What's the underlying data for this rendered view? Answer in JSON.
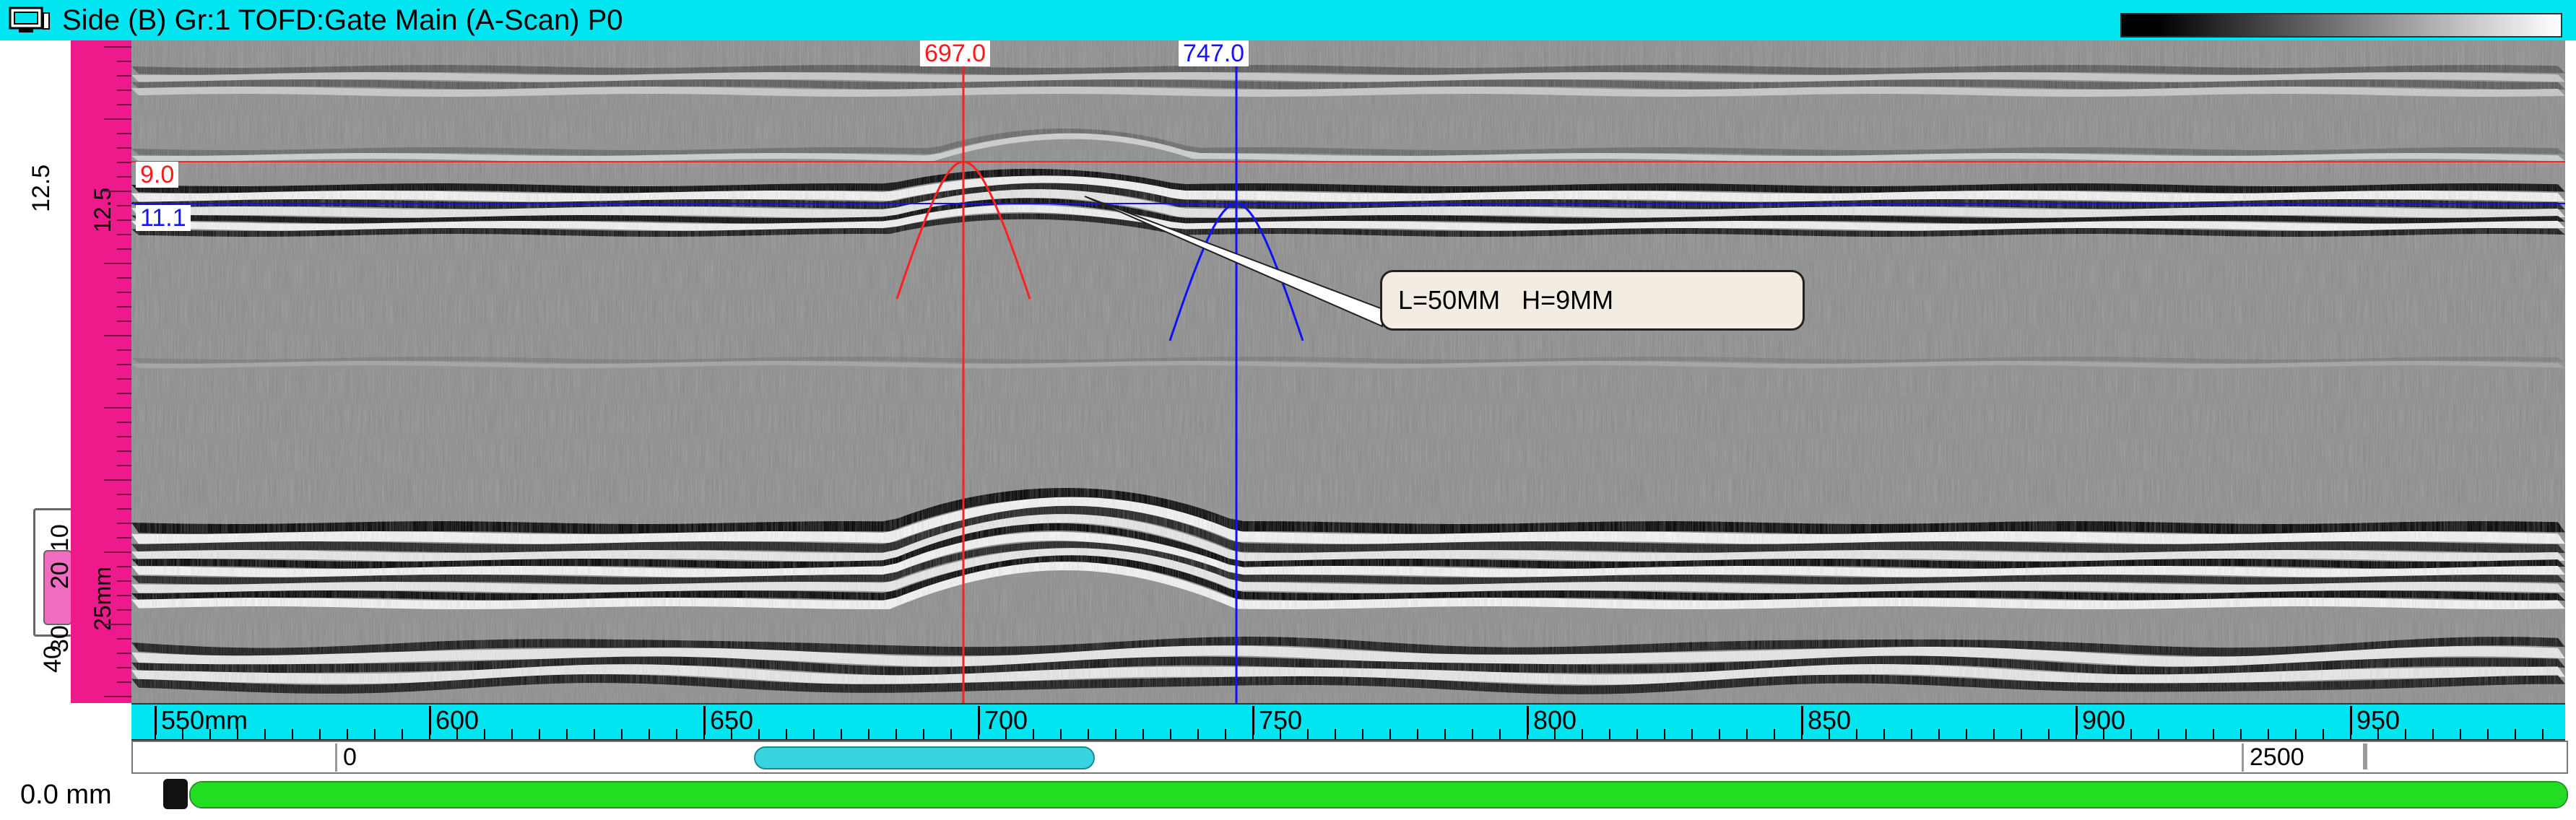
{
  "window": {
    "title": "Side (B) Gr:1 TOFD:Gate Main (A-Scan) P0",
    "icon": "monitor-icon",
    "accent_color": "#00e5f0"
  },
  "left_ruler": {
    "labels": [
      "12.5",
      "10",
      "20",
      "30",
      "25mm",
      "40"
    ]
  },
  "cursors": {
    "reference_position": "697.0",
    "measure_position": "747.0",
    "reference_depth": "9.0",
    "measure_depth": "11.1",
    "reference_color": "#ff2020",
    "measure_color": "#1010ff"
  },
  "measurement": {
    "label": "L=50MM   H=9MM"
  },
  "scan_axis": {
    "labels": [
      "550mm",
      "600",
      "650",
      "700",
      "750",
      "800",
      "850",
      "900",
      "950"
    ]
  },
  "scrollbar": {
    "start_label": "0",
    "end_label": "2500"
  },
  "status": {
    "position": "0.0 mm",
    "progress": 1.0
  }
}
